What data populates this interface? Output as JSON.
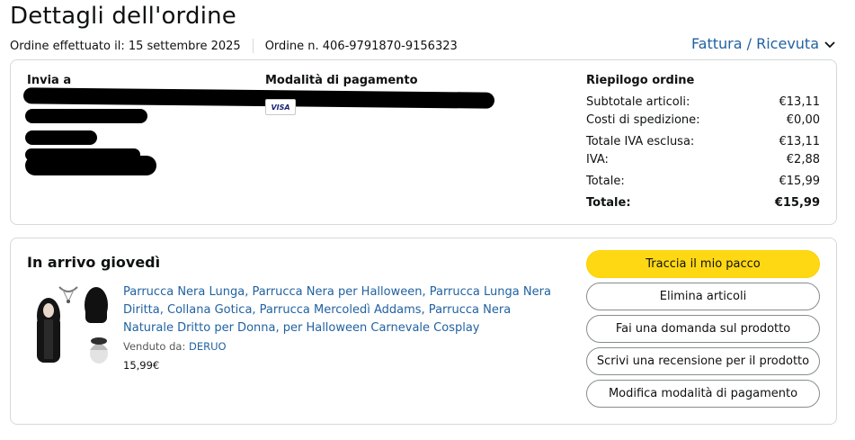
{
  "header": {
    "title": "Dettagli dell'ordine",
    "order_date": "Ordine effettuato il: 15 settembre 2025",
    "order_number": "Ordine n. 406-9791870-9156323",
    "invoice_link": "Fattura / Ricevuta"
  },
  "shipping": {
    "heading": "Invia a"
  },
  "payment": {
    "heading": "Modalità di pagamento",
    "card_brand": "VISA"
  },
  "summary": {
    "heading": "Riepilogo ordine",
    "rows": [
      {
        "label": "Subtotale articoli:",
        "value": "€13,11"
      },
      {
        "label": "Costi di spedizione:",
        "value": "€0,00"
      },
      {
        "label": "Totale IVA esclusa:",
        "value": "€13,11"
      },
      {
        "label": "IVA:",
        "value": "€2,88"
      },
      {
        "label": "Totale:",
        "value": "€15,99"
      },
      {
        "label": "Totale:",
        "value": "€15,99"
      }
    ]
  },
  "shipment": {
    "status": "In arrivo giovedì",
    "product_title": "Parrucca Nera Lunga, Parrucca Nera per Halloween, Parrucca Lunga Nera Diritta, Collana Gotica, Parrucca Mercoledì Addams, Parrucca Nera Naturale Dritto per Donna, per Halloween Carnevale Cosplay",
    "sold_by_label": "Venduto da:",
    "seller": "DERUO",
    "price": "15,99€"
  },
  "actions": {
    "track": "Traccia il mio pacco",
    "delete": "Elimina articoli",
    "question": "Fai una domanda sul prodotto",
    "review": "Scrivi una recensione per il prodotto",
    "payment": "Modifica modalità di pagamento"
  },
  "colors": {
    "link": "#2162a1",
    "primary_button": "#ffd814",
    "border": "#d5d9d9"
  }
}
